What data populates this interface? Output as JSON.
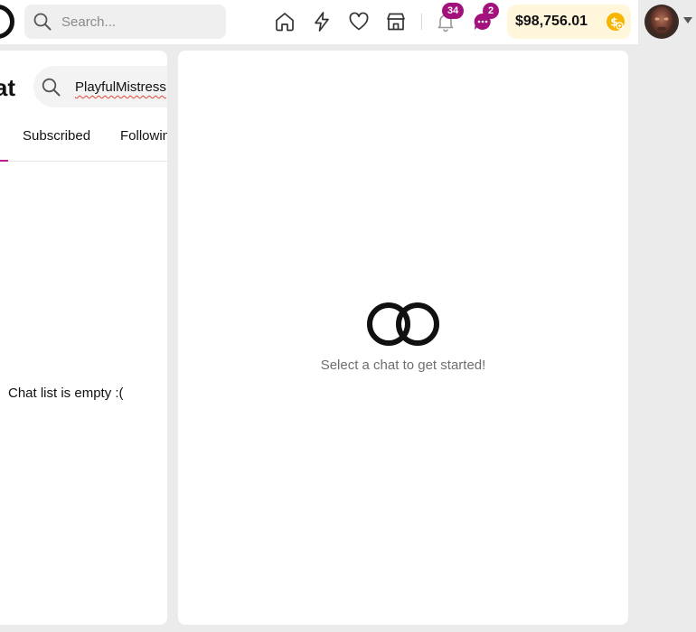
{
  "header": {
    "search_placeholder": "Search...",
    "notifications_count": "34",
    "messages_count": "2",
    "balance": "$98,756.01",
    "icons": [
      "home-icon",
      "lightning-icon",
      "heart-icon",
      "store-icon",
      "bell-icon",
      "chat-bubble-icon",
      "coin-icon"
    ]
  },
  "chat_list": {
    "title": "hat",
    "search_value": "PlayfulMistress",
    "tabs": [
      "Subscribed",
      "Followin"
    ],
    "empty_message": "Chat list is empty :("
  },
  "chat_view": {
    "empty_prompt": "Select a chat to get started!"
  },
  "colors": {
    "accent": "#a3117c",
    "balance_bg": "#fff6dc",
    "coin": "#f7b500"
  }
}
